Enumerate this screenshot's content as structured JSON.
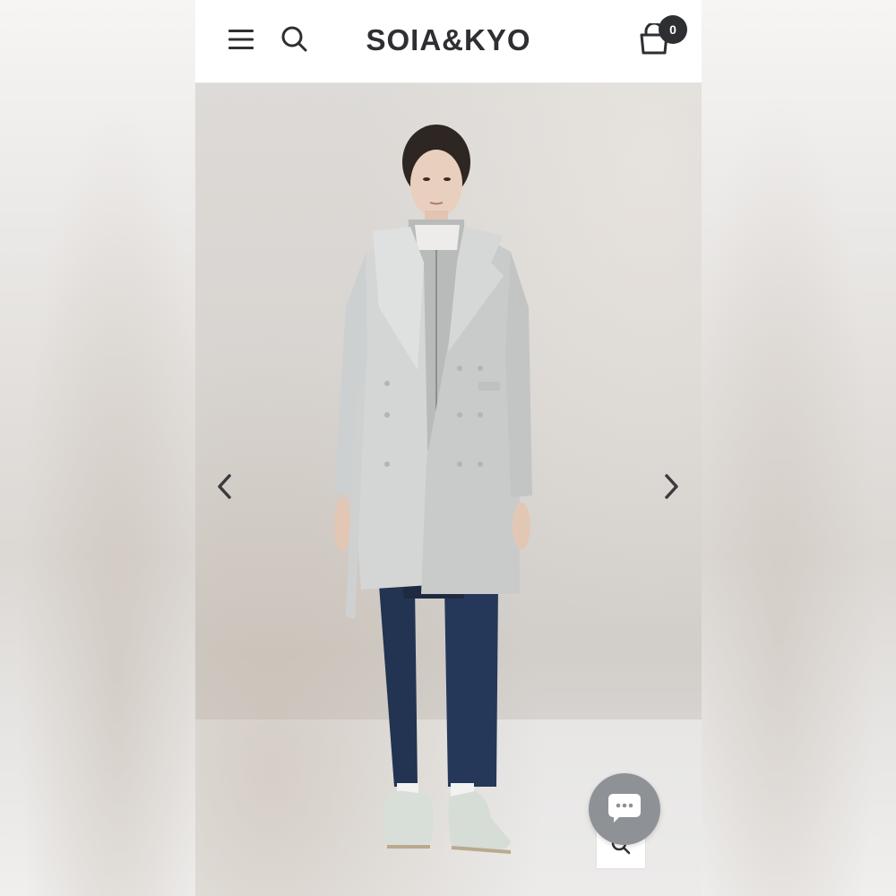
{
  "header": {
    "logo_text": "SOIA&KYO",
    "cart_count": "0"
  },
  "icons": {
    "menu": "hamburger-menu-icon",
    "search": "search-icon",
    "cart": "shopping-bag-icon",
    "prev": "chevron-left-icon",
    "next": "chevron-right-icon",
    "zoom": "magnifier-icon",
    "chat": "chat-bubble-icon"
  },
  "colors": {
    "header_bg": "#ffffff",
    "logo": "#2f2f33",
    "badge_bg": "#2d2f33",
    "chat_bg": "#8e9196",
    "coat": "#cfd1d1",
    "jeans": "#223451"
  }
}
